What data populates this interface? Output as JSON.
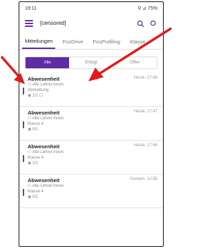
{
  "status_bar": {
    "time": "19:11",
    "right": "⚲ ⊿ 75%"
  },
  "header": {
    "name": "[censored]",
    "subtitle": ""
  },
  "tabs": [
    {
      "label": "Mitteilungen"
    },
    {
      "label": "FosDrive"
    },
    {
      "label": "FosProfiling"
    },
    {
      "label": "Klasse"
    }
  ],
  "filters": [
    {
      "label": "Alle"
    },
    {
      "label": "Erfolgt"
    },
    {
      "label": "Offen"
    }
  ],
  "messages": [
    {
      "title": "Abwesenheit",
      "time": "Heute, 17:48",
      "to": "Alle Lehrer:innen",
      "class": "Abmeldung",
      "read": "1/1"
    },
    {
      "title": "Abwesenheit",
      "time": "Heute, 17:47",
      "to": "Alle Lehrer:innen",
      "class": "Klasse 4",
      "read": "0/1"
    },
    {
      "title": "Abwesenheit",
      "time": "Heute, 17:46",
      "to": "Alle Lehrer:innen",
      "class": "Klasse 4",
      "read": "1/1"
    },
    {
      "title": "Abwesenheit",
      "time": "Gestern, 10:55",
      "to": "Alle Lehrer:innen",
      "class": "Klasse 4",
      "read": "0/1"
    }
  ],
  "colors": {
    "accent": "#5e2ca5",
    "arrow": "#e01b1b"
  }
}
